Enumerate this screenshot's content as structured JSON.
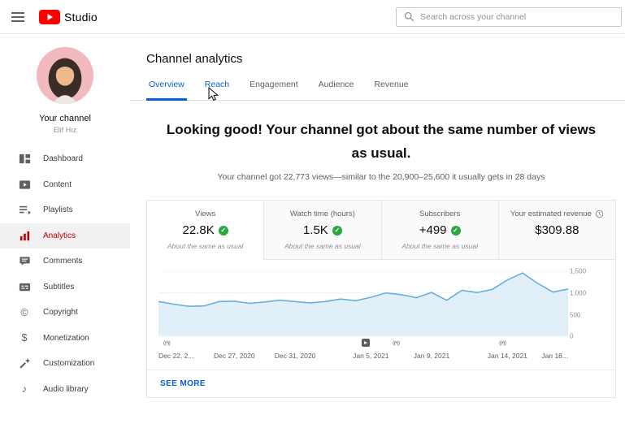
{
  "colors": {
    "brand_red": "#ff0000",
    "active_red": "#c00000",
    "accent_blue": "#065fd4",
    "positive_green": "#2ba640"
  },
  "icons": {
    "check": "✓",
    "live_marker": "((•))",
    "copyright": "©",
    "monetization": "$",
    "audio": "♪"
  },
  "topbar": {
    "product_name": "Studio",
    "search": {
      "placeholder": "Search across your channel"
    }
  },
  "sidebar": {
    "channel_name": "Your channel",
    "owner_name": "Elif Hız",
    "items": [
      {
        "label": "Dashboard",
        "active": false
      },
      {
        "label": "Content",
        "active": false
      },
      {
        "label": "Playlists",
        "active": false
      },
      {
        "label": "Analytics",
        "active": true
      },
      {
        "label": "Comments",
        "active": false
      },
      {
        "label": "Subtitles",
        "active": false
      },
      {
        "label": "Copyright",
        "active": false
      },
      {
        "label": "Monetization",
        "active": false
      },
      {
        "label": "Customization",
        "active": false
      },
      {
        "label": "Audio library",
        "active": false
      }
    ]
  },
  "main": {
    "page_title": "Channel analytics",
    "tabs": [
      {
        "label": "Overview",
        "active": true
      },
      {
        "label": "Reach",
        "hovered": true
      },
      {
        "label": "Engagement",
        "active": false
      },
      {
        "label": "Audience",
        "active": false
      },
      {
        "label": "Revenue",
        "active": false
      }
    ],
    "headline": "Looking good! Your channel got about the same number of views as usual.",
    "summary": "Your channel got 22,773 views—similar to the 20,900–25,600 it usually gets in 28 days",
    "metric_cards": [
      {
        "label": "Views",
        "value": "22.8K",
        "note": "About the same as usual",
        "selected": true
      },
      {
        "label": "Watch time (hours)",
        "value": "1.5K",
        "note": "About the same as usual",
        "selected": false
      },
      {
        "label": "Subscribers",
        "value": "+499",
        "note": "About the same as usual",
        "selected": false
      },
      {
        "label": "Your estimated revenue",
        "value": "$309.88",
        "selected": false
      }
    ],
    "see_more_label": "SEE MORE"
  },
  "chart_data": {
    "type": "area",
    "metric": "Views per day",
    "line_color": "#67aede",
    "area_color": "#e1eff9",
    "ylim": [
      0,
      1500
    ],
    "x": [
      "Dec 22",
      "Dec 23",
      "Dec 24",
      "Dec 25",
      "Dec 26",
      "Dec 27",
      "Dec 28",
      "Dec 29",
      "Dec 30",
      "Dec 31",
      "Jan 1",
      "Jan 2",
      "Jan 3",
      "Jan 4",
      "Jan 5",
      "Jan 6",
      "Jan 7",
      "Jan 8",
      "Jan 9",
      "Jan 10",
      "Jan 11",
      "Jan 12",
      "Jan 13",
      "Jan 14",
      "Jan 15",
      "Jan 16",
      "Jan 17",
      "Jan 18"
    ],
    "values": [
      800,
      740,
      690,
      700,
      800,
      810,
      760,
      790,
      830,
      800,
      770,
      800,
      860,
      820,
      900,
      1000,
      960,
      890,
      1010,
      830,
      1060,
      1010,
      1080,
      1300,
      1460,
      1220,
      1020,
      1090
    ],
    "y_ticks": [
      {
        "value": 1500,
        "label": "1,500"
      },
      {
        "value": 1000,
        "label": "1,000"
      },
      {
        "value": 500,
        "label": "500"
      },
      {
        "value": 0,
        "label": "0"
      }
    ],
    "x_ticks": [
      {
        "index": 0,
        "label": "Dec 22, 2..."
      },
      {
        "index": 5,
        "label": "Dec 27, 2020"
      },
      {
        "index": 9,
        "label": "Dec 31, 2020"
      },
      {
        "index": 14,
        "label": "Jan 5, 2021"
      },
      {
        "index": 18,
        "label": "Jan 9, 2021"
      },
      {
        "index": 23,
        "label": "Jan 14, 2021"
      },
      {
        "index": 27,
        "label": "Jan 18..."
      }
    ],
    "markers": [
      {
        "type": "live",
        "position": 0.02
      },
      {
        "type": "video",
        "position": 0.505
      },
      {
        "type": "live",
        "position": 0.58
      },
      {
        "type": "live",
        "position": 0.84
      }
    ]
  }
}
